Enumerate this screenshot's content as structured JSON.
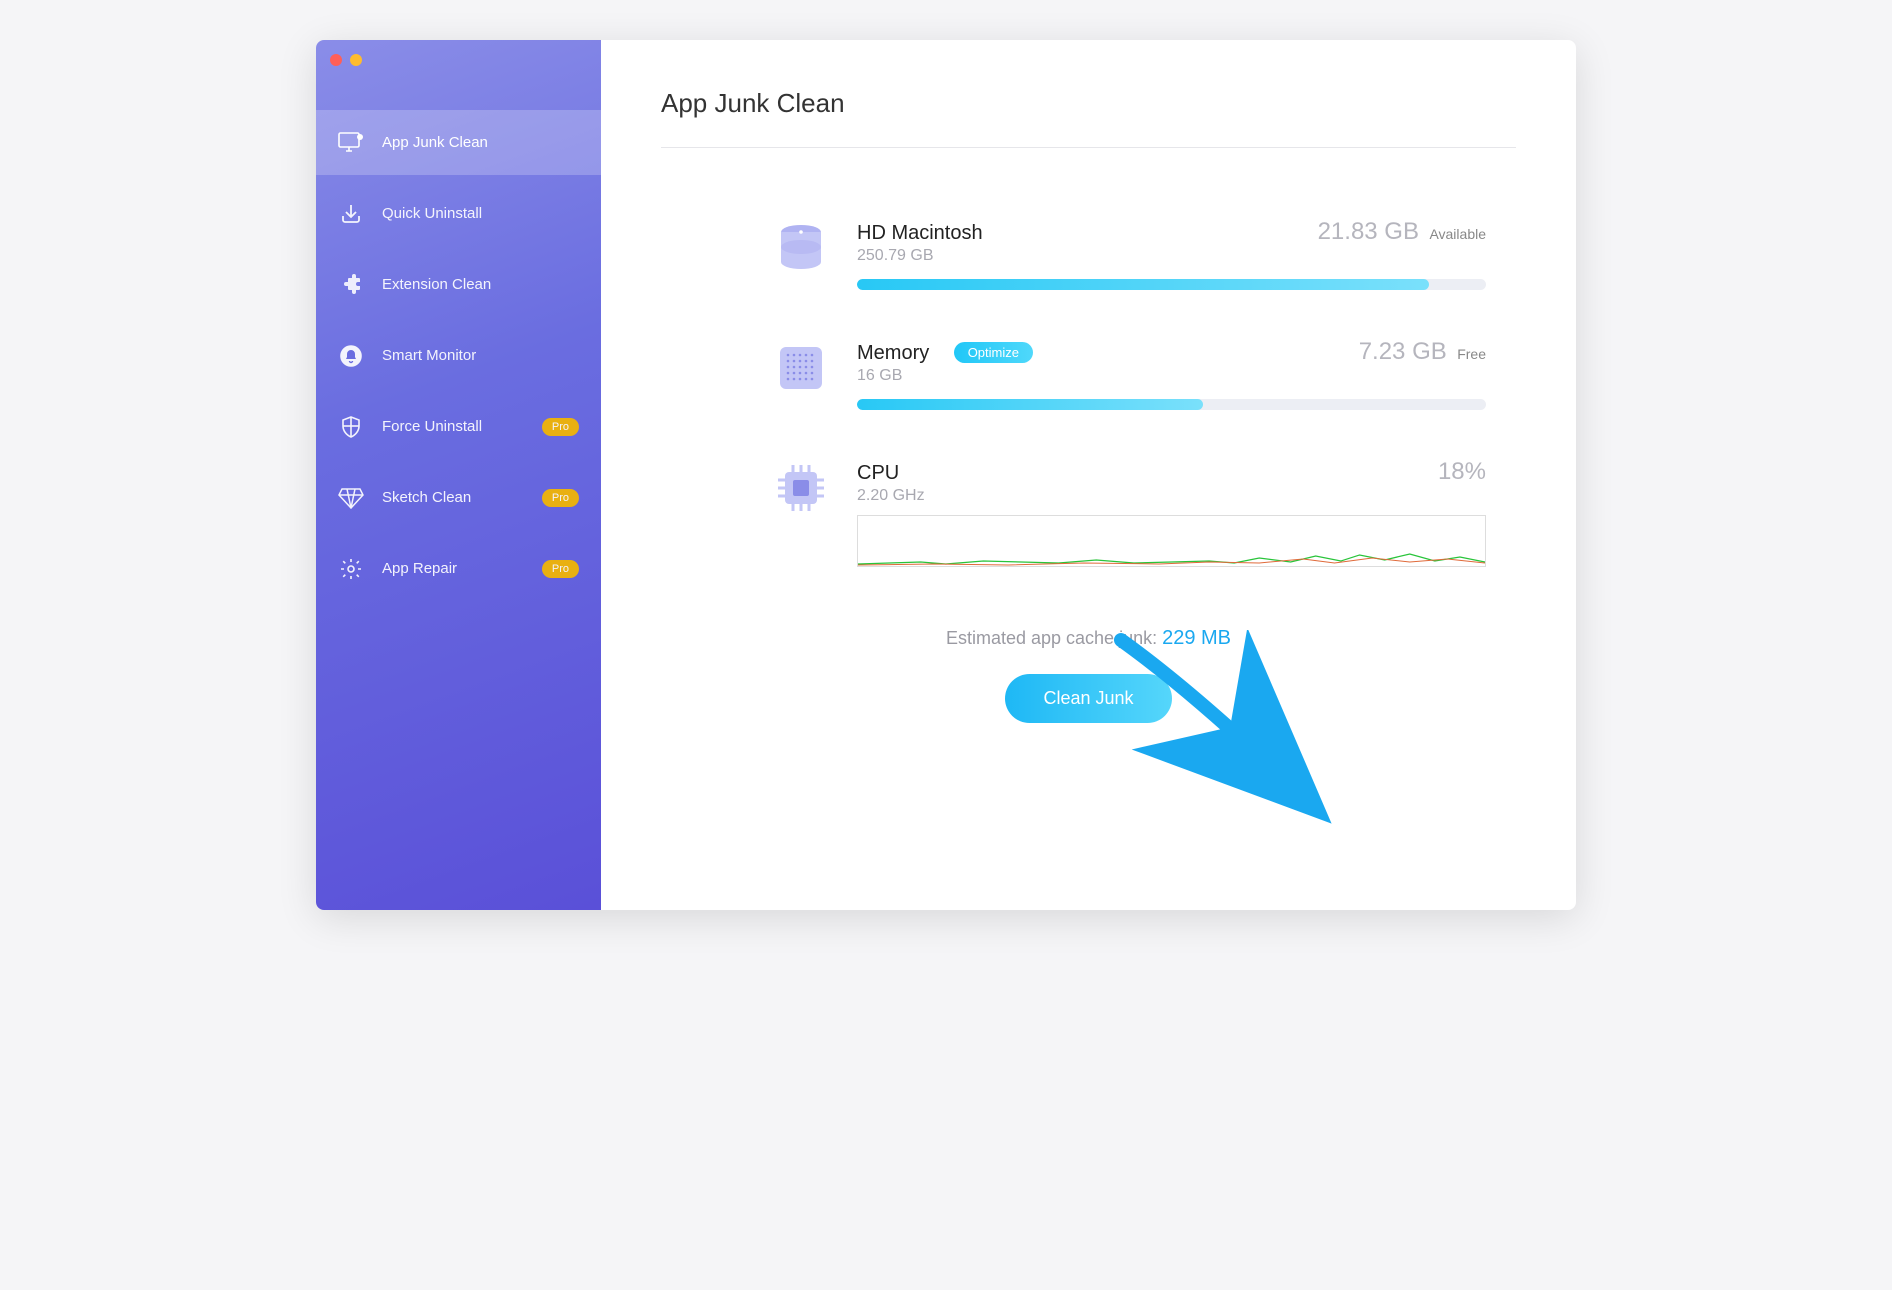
{
  "sidebar": {
    "items": [
      {
        "label": "App Junk Clean",
        "icon": "monitor-clean-icon",
        "pro": false,
        "active": true
      },
      {
        "label": "Quick Uninstall",
        "icon": "uninstall-icon",
        "pro": false,
        "active": false
      },
      {
        "label": "Extension Clean",
        "icon": "puzzle-icon",
        "pro": false,
        "active": false
      },
      {
        "label": "Smart Monitor",
        "icon": "bell-icon",
        "pro": false,
        "active": false
      },
      {
        "label": "Force Uninstall",
        "icon": "shield-icon",
        "pro": true,
        "active": false
      },
      {
        "label": "Sketch Clean",
        "icon": "diamond-icon",
        "pro": true,
        "active": false
      },
      {
        "label": "App Repair",
        "icon": "gear-icon",
        "pro": true,
        "active": false
      }
    ],
    "pro_label": "Pro"
  },
  "page": {
    "title": "App Junk Clean"
  },
  "disk": {
    "name": "HD Macintosh",
    "total": "250.79 GB",
    "available_value": "21.83 GB",
    "available_label": "Available",
    "used_percent": 91
  },
  "memory": {
    "name": "Memory",
    "optimize_label": "Optimize",
    "total": "16 GB",
    "free_value": "7.23 GB",
    "free_label": "Free",
    "used_percent": 55
  },
  "cpu": {
    "name": "CPU",
    "clock": "2.20 GHz",
    "usage": "18%"
  },
  "estimate": {
    "prefix": "Estimated app cache junk: ",
    "value": "229 MB"
  },
  "clean_button": "Clean Junk"
}
